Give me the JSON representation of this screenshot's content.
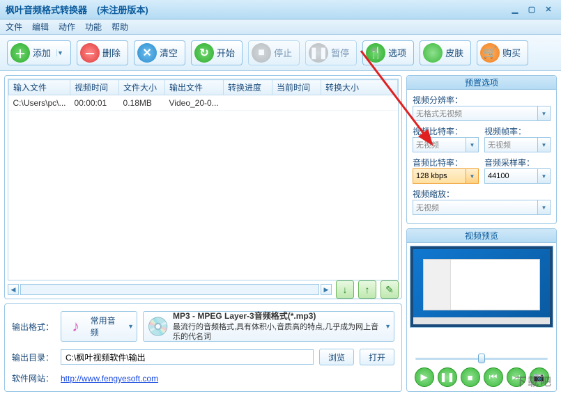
{
  "title": {
    "app": "枫叶音频格式转换器",
    "suffix": "(未注册版本)"
  },
  "menu": {
    "file": "文件",
    "edit": "编辑",
    "action": "动作",
    "function": "功能",
    "help": "帮助"
  },
  "toolbar": {
    "add": "添加",
    "delete": "删除",
    "clear": "清空",
    "start": "开始",
    "stop": "停止",
    "pause": "暂停",
    "options": "选项",
    "skin": "皮肤",
    "buy": "购买"
  },
  "table": {
    "headers": {
      "input": "输入文件",
      "vtime": "视频时间",
      "fsize": "文件大小",
      "output": "输出文件",
      "progress": "转换进度",
      "ctime": "当前时间",
      "csize": "转换大小"
    },
    "rows": [
      {
        "input": "C:\\Users\\pc\\...",
        "vtime": "00:00:01",
        "fsize": "0.18MB",
        "output": "Video_20-0...",
        "progress": "",
        "ctime": "",
        "csize": ""
      }
    ]
  },
  "output": {
    "format_label": "输出格式：",
    "format_category": "常用音频",
    "format_name": "MP3 - MPEG Layer-3音频格式(*.mp3)",
    "format_desc": "最流行的音频格式,具有体积小,音质高的特点,几乎成为网上音乐的代名词",
    "dir_label": "输出目录：",
    "dir_value": "C:\\枫叶视频软件\\输出",
    "browse": "浏览",
    "open": "打开",
    "site_label": "软件网站：",
    "site_url": "http://www.fengyesoft.com"
  },
  "presets": {
    "header": "预置选项",
    "res_label": "视频分辨率：",
    "res_value": "无格式无视频",
    "vbr_label": "视频比特率：",
    "vbr_value": "无视频",
    "fps_label": "视频帧率：",
    "fps_value": "无视频",
    "abr_label": "音频比特率：",
    "abr_value": "128 kbps",
    "asr_label": "音频采样率：",
    "asr_value": "44100",
    "zoom_label": "视频缩放：",
    "zoom_value": "无视频"
  },
  "preview": {
    "header": "视频预览"
  },
  "watermark": "下载吧"
}
